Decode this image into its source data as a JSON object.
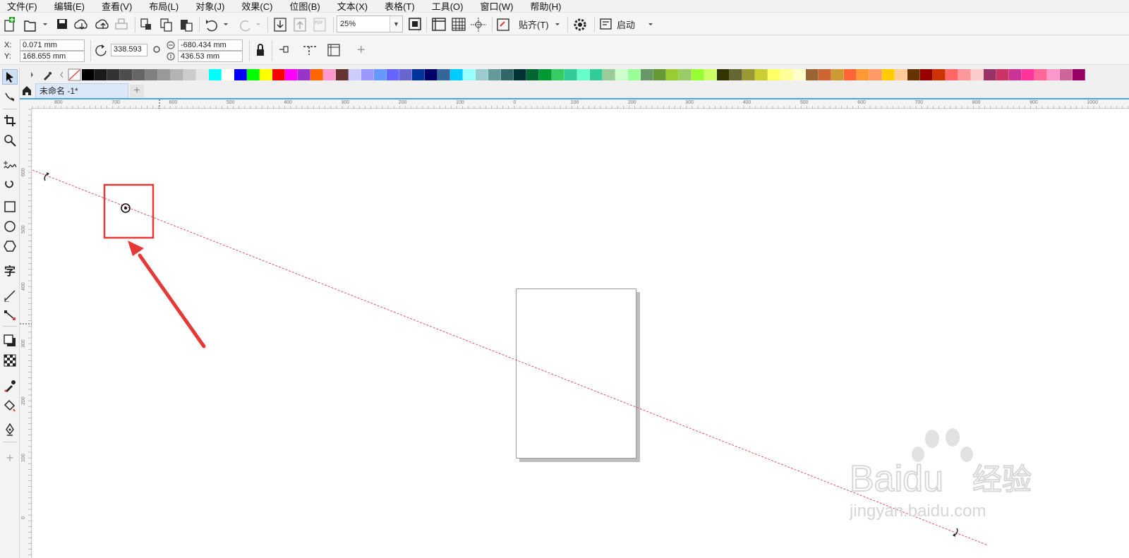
{
  "menu": [
    "文件(F)",
    "编辑(E)",
    "查看(V)",
    "布局(L)",
    "对象(J)",
    "效果(C)",
    "位图(B)",
    "文本(X)",
    "表格(T)",
    "工具(O)",
    "窗口(W)",
    "帮助(H)"
  ],
  "toolbar": {
    "zoom": "25%",
    "snap_label": "贴齐(T)",
    "launch_label": "启动",
    "pdf_label": "PDF"
  },
  "property_bar": {
    "x_label": "X:",
    "x_value": "0.071 mm",
    "y_label": "Y:",
    "y_value": "168.655 mm",
    "rotation_value": "338.593",
    "center_x_value": "-680.434 mm",
    "center_y_value": "436.53 mm",
    "add_label": "+"
  },
  "document_tab": {
    "name": "未命名 -1*",
    "add_label": "+"
  },
  "palette_colors": [
    "#000000",
    "#1a1a1a",
    "#333333",
    "#4d4d4d",
    "#666666",
    "#808080",
    "#999999",
    "#b3b3b3",
    "#cccccc",
    "#e6e6e6",
    "#00ffff",
    "#ffffff",
    "#0000ff",
    "#00ff00",
    "#ffff00",
    "#ff0000",
    "#ff00ff",
    "#9933cc",
    "#ff6600",
    "#ff99cc",
    "#663333",
    "#ccccff",
    "#9999ff",
    "#6699ff",
    "#6666ff",
    "#6666cc",
    "#003399",
    "#000066",
    "#336699",
    "#00ccff",
    "#99ffff",
    "#99cccc",
    "#669999",
    "#336666",
    "#003333",
    "#006633",
    "#009933",
    "#33cc66",
    "#33cc99",
    "#66ffcc",
    "#33cc99",
    "#99cc99",
    "#ccffcc",
    "#99ff99",
    "#669966",
    "#669933",
    "#99cc33",
    "#99cc66",
    "#99ff33",
    "#ccff66",
    "#333300",
    "#666633",
    "#999933",
    "#cccc33",
    "#ffff66",
    "#ffff99",
    "#ffffcc",
    "#996633",
    "#cc6633",
    "#cc9933",
    "#ff6633",
    "#ff9933",
    "#ff9966",
    "#ffcc00",
    "#ffcc99",
    "#663300",
    "#990000",
    "#cc3300",
    "#ff6666",
    "#ff9999",
    "#ffcccc",
    "#993366",
    "#cc3366",
    "#cc3399",
    "#ff3399",
    "#ff6699",
    "#ff99cc",
    "#cc6699",
    "#990066"
  ],
  "ruler_h": [
    "800",
    "700",
    "600",
    "500",
    "400",
    "300",
    "200",
    "100",
    "0",
    "100",
    "200",
    "300",
    "400",
    "500",
    "600",
    "700",
    "800",
    "900",
    "1000"
  ],
  "ruler_v": [
    "600",
    "500",
    "400",
    "300",
    "200",
    "100",
    "0",
    "100"
  ],
  "watermark": {
    "brand": "Baidu",
    "brand_cn": "经验",
    "url": "jingyan.baidu.com"
  },
  "accent_color": "#e53935"
}
